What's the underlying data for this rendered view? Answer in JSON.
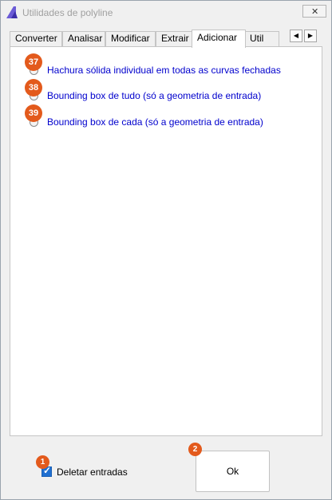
{
  "window": {
    "title": "Utilidades de polyline",
    "close_glyph": "✕"
  },
  "tabs": [
    {
      "label": "Converter"
    },
    {
      "label": "Analisar"
    },
    {
      "label": "Modificar"
    },
    {
      "label": "Extrair"
    },
    {
      "label": "Adicionar",
      "active": true
    },
    {
      "label": "Util"
    }
  ],
  "scroll": {
    "left": "◀",
    "right": "▶"
  },
  "options": [
    {
      "badge": "37",
      "label": "Hachura sólida individual em todas as curvas fechadas"
    },
    {
      "badge": "38",
      "label": "Bounding box de tudo (só a geometria de entrada)"
    },
    {
      "badge": "39",
      "label": "Bounding box de cada (só a geometria de entrada)"
    }
  ],
  "footer": {
    "delete_badge": "1",
    "delete_label": "Deletar entradas",
    "delete_checked": true,
    "check_glyph": "✓",
    "ok_badge": "2",
    "ok_label": "Ok"
  },
  "colors": {
    "link_blue": "#0000cd",
    "badge_orange": "#e35a1c",
    "checkbox_blue": "#1f6fd1"
  },
  "icons": {
    "app": "polyline-app-icon",
    "close": "close-icon",
    "scroll_left": "arrow-left-icon",
    "scroll_right": "arrow-right-icon"
  }
}
